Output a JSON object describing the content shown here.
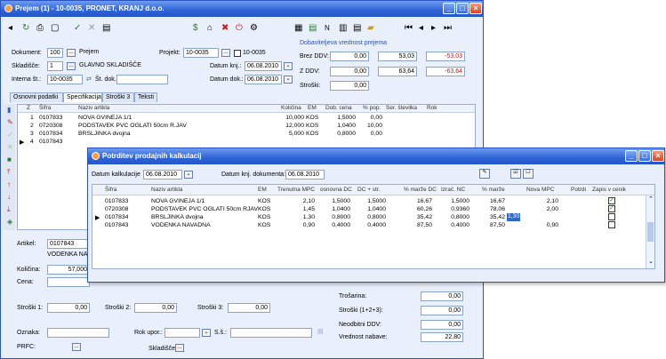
{
  "main": {
    "title": "Prejem (1) - 10-0035,  PRONET, KRANJ d.o.o.",
    "toolbar_right": "N",
    "dobavitelj_header": "Dobaviteljeva vrednost prejema",
    "dokument_label": "Dokument:",
    "dokument_value": "100",
    "dokument_type": "Prejem",
    "projekt_label": "Projekt:",
    "projekt_value": "10-0035",
    "projekt_check": "10-0035",
    "skladisce_label": "Skladišče:",
    "skladisce_value": "1",
    "skladisce_name": "GLAVNO SKLADIŠČE",
    "interna_label": "Interna št.:",
    "interna_value": "10-0035",
    "st_dok_label": "Št. dok.:",
    "datum_knj_label": "Datum knj.:",
    "datum_knj_value": "06.08.2010",
    "datum_dok_label": "Datum dok.:",
    "datum_dok_value": "06.08.2010",
    "brez_ddv_label": "Brez DDV:",
    "brez_ddv_value": "0,00",
    "brez_ddv_v2": "53,03",
    "brez_ddv_v3": "-53,03",
    "z_ddv_label": "Z DDV:",
    "z_ddv_value": "0,00",
    "z_ddv_v2": "63,64",
    "z_ddv_v3": "-63,64",
    "stroski_label": "Stroški:",
    "stroski_value": "0,00",
    "tabs": [
      "Osnovni podatki",
      "Specifikacija",
      "Stroški 3",
      "Teksti"
    ],
    "grid_headers": [
      "Z",
      "Šifra",
      "Naziv artikla",
      "Količina",
      "EM",
      "Dob. cena",
      "% pop.",
      "Ser. številka",
      "Rok"
    ],
    "grid_rows": [
      {
        "n": "1",
        "sifra": "0107833",
        "naziv": "NOVA GVINEJA 1/1",
        "kol": "10,000",
        "em": "KOS",
        "cena": "1,5000",
        "pop": "0,00"
      },
      {
        "n": "2",
        "sifra": "0720308",
        "naziv": "PODSTAVEK PVC OGLATI  50cm R.JAV",
        "kol": "12,000",
        "em": "KOS",
        "cena": "1,0400",
        "pop": "10,00"
      },
      {
        "n": "3",
        "sifra": "0107834",
        "naziv": "BRŠLJINKA dvojna",
        "kol": "5,000",
        "em": "KOS",
        "cena": "0,8000",
        "pop": "0,00"
      },
      {
        "n": "4",
        "sifra": "0107843",
        "naziv": "",
        "kol": "",
        "em": "",
        "cena": "",
        "pop": ""
      }
    ],
    "artikel_label": "Artikel:",
    "artikel_value": "0107843",
    "artikel_name": "VODENKA NAVA",
    "kolicina_label": "Količina:",
    "kolicina_value": "57,000",
    "cena_label": "Cena:",
    "stroski1_label": "Stroški 1:",
    "stroski1_value": "0,00",
    "stroski2_label": "Stroški 2:",
    "stroski2_value": "0,00",
    "stroski3_label": "Stroški 3:",
    "stroski3_value": "0,00",
    "oznaka_label": "Oznaka:",
    "rok_upor_label": "Rok upor.:",
    "ss_label": "S.š.:",
    "prfc_label": "PRFC:",
    "skladisce2_label": "Skladišče:",
    "trosarina_label": "Trošarina:",
    "trosarina_value": "0,00",
    "stroski123_label": "Stroški (1+2+3):",
    "stroski123_value": "0,00",
    "neodbitni_label": "Neodbitni DDV:",
    "neodbitni_value": "0,00",
    "vrednost_label": "Vrednost nabave:",
    "vrednost_value": "22,80"
  },
  "dialog": {
    "title": "Potrditev prodajnih kalkulacij",
    "datum_kalk_label": "Datum kalkulacije",
    "datum_kalk_value": "06.08.2010",
    "datum_knj_label": "Datum knj. dokumenta:",
    "datum_knj_value": "06.08.2010",
    "headers": [
      "Šifra",
      "Naziv artikla",
      "EM",
      "Trenutna MPC",
      "osnovna DC",
      "DC + str.",
      "% marže DC",
      "Izrač. NC",
      "% marže",
      "Nova MPC",
      "Potrdi",
      "Zapis v cenik"
    ],
    "rows": [
      {
        "sifra": "0107833",
        "naziv": "NOVA GVINEJA  1/1",
        "em": "KOS",
        "mpc": "2,10",
        "dc": "1,5000",
        "dcs": "1,5000",
        "mdc": "16,67",
        "nc": "1,5000",
        "marza": "16,67",
        "nova": "2,10",
        "zapis": "✓"
      },
      {
        "sifra": "0720308",
        "naziv": "PODSTAVEK PVC OGLATI  50cm RJAV",
        "em": "KOS",
        "mpc": "1,45",
        "dc": "1,0400",
        "dcs": "1,0400",
        "mdc": "60,26",
        "nc": "0,9360",
        "marza": "78,06",
        "nova": "2,00",
        "zapis": "✓"
      },
      {
        "sifra": "0107834",
        "naziv": "BRŠLJINKA dvojna",
        "em": "KOS",
        "mpc": "1,30",
        "dc": "0,8000",
        "dcs": "0,8000",
        "mdc": "35,42",
        "nc": "0,8000",
        "marza": "35,42",
        "nova": "1,30",
        "zapis": ""
      },
      {
        "sifra": "0107843",
        "naziv": "VODENKA NAVADNA",
        "em": "KOS",
        "mpc": "0,90",
        "dc": "0,4000",
        "dcs": "0,4000",
        "mdc": "87,50",
        "nc": "0,4000",
        "marza": "87,50",
        "nova": "0,90",
        "zapis": ""
      }
    ],
    "confirm_icon": "✓"
  },
  "colors": {
    "title_blue": "#2e63d6",
    "negative_red": "#d01010",
    "selection_blue": "#3169c6"
  }
}
